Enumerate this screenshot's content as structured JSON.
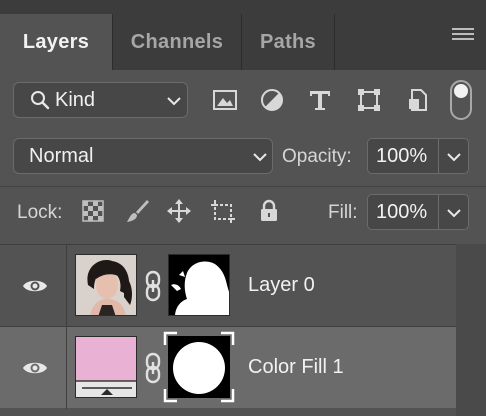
{
  "tabs": [
    {
      "label": "Layers",
      "active": true
    },
    {
      "label": "Channels",
      "active": false
    },
    {
      "label": "Paths",
      "active": false
    }
  ],
  "filter": {
    "kind_label": "Kind",
    "icons": [
      "image-filter-icon",
      "adjustment-filter-icon",
      "type-filter-icon",
      "shape-filter-icon",
      "smart-object-filter-icon"
    ]
  },
  "blend": {
    "mode": "Normal",
    "opacity_label": "Opacity:",
    "opacity_value": "100%"
  },
  "lock": {
    "label": "Lock:",
    "fill_label": "Fill:",
    "fill_value": "100%"
  },
  "layers": [
    {
      "name": "Layer 0",
      "selected": false,
      "thumb": "photo"
    },
    {
      "name": "Color Fill 1",
      "selected": true,
      "thumb_color": "#e9b2d4"
    }
  ],
  "colors": {
    "panel_bg": "#535353",
    "tabbar_bg": "#3c3c3c",
    "selected_row": "#6b6b6b",
    "fill_swatch": "#e9b2d4"
  }
}
